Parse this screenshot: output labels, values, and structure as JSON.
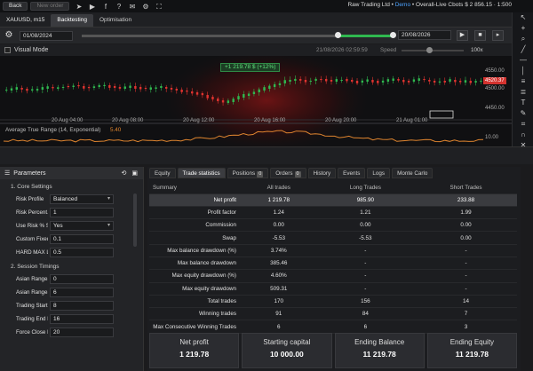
{
  "topbar": {
    "back": "Back",
    "new_order": "New order",
    "broker": "Raw Trading Ltd",
    "account_type": "Demo",
    "account_info": "Overall-Live Cbots",
    "balance_info": "$ 2 856.15 · 1:500"
  },
  "tabs": {
    "symbol": "XAUUSD",
    "timeframe": "m15",
    "backtesting": "Backtesting",
    "optimisation": "Optimisation"
  },
  "controls": {
    "start_date": "01/08/2024",
    "end_date": "20/08/2026"
  },
  "visual": {
    "label": "Visual Mode",
    "timestamp": "21/08/2026 02:59:59",
    "speed_label": "Speed",
    "speed_value": "100x"
  },
  "chart": {
    "pnl_badge": "+1 219.78 $ (+12%)",
    "price_levels": [
      "4550.00",
      "4500.00",
      "4450.00"
    ],
    "current_price": "4520.37",
    "time_labels": [
      "20 Aug 04:00",
      "20 Aug 08:00",
      "20 Aug 12:00",
      "20 Aug 16:00",
      "20 Aug 20:00",
      "21 Aug 01:00"
    ],
    "indicator_title": "Average True Range (14, Exponential)",
    "indicator_value": "5.40",
    "indicator_level": "10.00",
    "bull_color": "#2fb84f",
    "bear_color": "#e0332f",
    "atr_color": "#e0852f"
  },
  "params": {
    "title": "Parameters",
    "section1": "1. Core Settings",
    "rows1": [
      {
        "label": "Risk Profile",
        "value": "Balanced",
        "dropdown": true
      },
      {
        "label": "Risk Percent...",
        "value": "1",
        "dropdown": false
      },
      {
        "label": "Use Risk % Si...",
        "value": "Yes",
        "dropdown": true
      },
      {
        "label": "Custom Fixed...",
        "value": "0.1",
        "dropdown": false
      },
      {
        "label": "HARD MAX L...",
        "value": "0.5",
        "dropdown": false
      }
    ],
    "section2": "2. Session Timings",
    "rows2": [
      {
        "label": "Asian Range...",
        "value": "0"
      },
      {
        "label": "Asian Range...",
        "value": "6"
      },
      {
        "label": "Trading Start...",
        "value": "8"
      },
      {
        "label": "Trading End H...",
        "value": "16"
      },
      {
        "label": "Force Close H...",
        "value": "20"
      }
    ]
  },
  "stats": {
    "tabs": [
      {
        "label": "Equity"
      },
      {
        "label": "Trade statistics"
      },
      {
        "label": "Positions",
        "count": "0"
      },
      {
        "label": "Orders",
        "count": "0"
      },
      {
        "label": "History"
      },
      {
        "label": "Events"
      },
      {
        "label": "Logs"
      },
      {
        "label": "Monte Carlo"
      }
    ],
    "header": [
      "Summary",
      "All trades",
      "Long Trades",
      "Short Trades"
    ],
    "rows": [
      [
        "Net profit",
        "1 219.78",
        "985.90",
        "233.88"
      ],
      [
        "Profit factor",
        "1.24",
        "1.21",
        "1.99"
      ],
      [
        "Commission",
        "0.00",
        "0.00",
        "0.00"
      ],
      [
        "Swap",
        "-5.53",
        "-5.53",
        "0.00"
      ],
      [
        "Max balance drawdown (%)",
        "3.74%",
        "-",
        "-"
      ],
      [
        "Max balance drawdown",
        "385.46",
        "-",
        "-"
      ],
      [
        "Max equity drawdown (%)",
        "4.60%",
        "-",
        "-"
      ],
      [
        "Max equity drawdown",
        "509.31",
        "-",
        "-"
      ],
      [
        "Total trades",
        "170",
        "156",
        "14"
      ],
      [
        "Winning trades",
        "91",
        "84",
        "7"
      ],
      [
        "Max Consecutive Winning Trades",
        "6",
        "6",
        "3"
      ]
    ],
    "cards": [
      {
        "label": "Net profit",
        "value": "1 219.78"
      },
      {
        "label": "Starting capital",
        "value": "10 000.00"
      },
      {
        "label": "Ending Balance",
        "value": "11 219.78"
      },
      {
        "label": "Ending Equity",
        "value": "11 219.78"
      }
    ]
  }
}
